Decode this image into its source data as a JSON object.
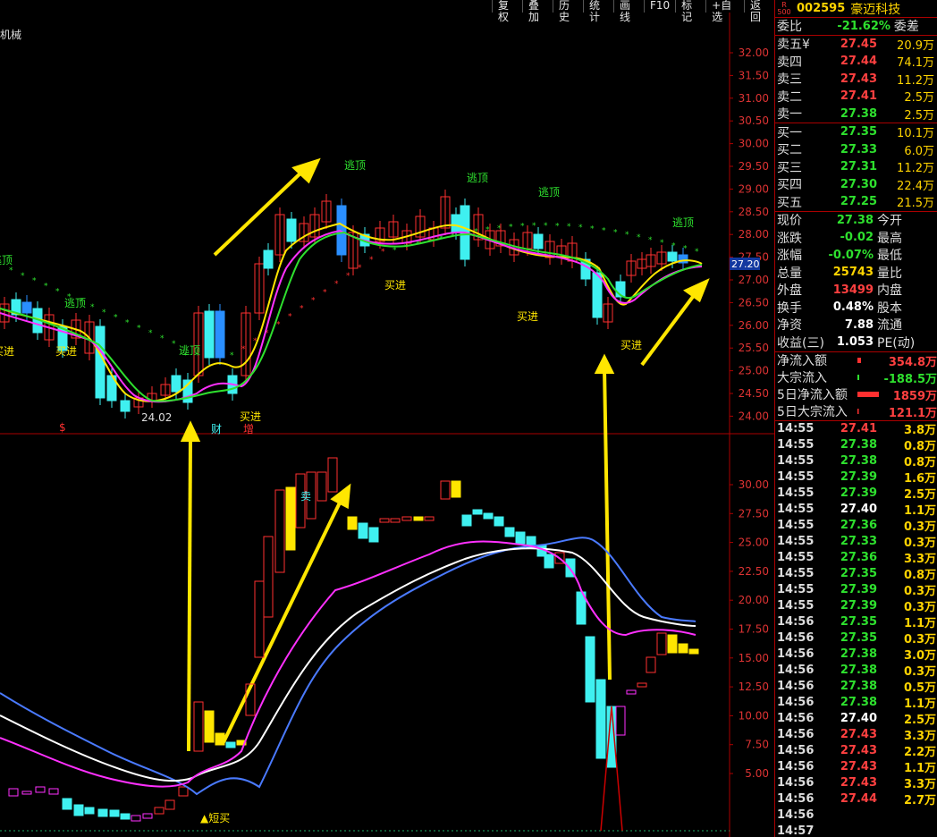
{
  "toolbar": {
    "items": [
      "复权",
      "叠加",
      "历史",
      "统计",
      "画线",
      "F10",
      "标记",
      "+自选",
      "返回"
    ]
  },
  "stock": {
    "code": "002595",
    "name": "豪迈科技",
    "sector_tag": "机械",
    "logo_top": "R",
    "logo_bottom": "500"
  },
  "chart_labels": {
    "current_price_tag": "27.20",
    "low_label": "24.02",
    "signals": {
      "escape_top": "逃顶",
      "buy_in": "买进",
      "sell_in": "卖进",
      "sell": "卖",
      "short_buy": "▲短买",
      "cai": "财",
      "zeng": "增",
      "dollar": "$"
    },
    "upper_axis": [
      "32.00",
      "31.50",
      "31.00",
      "30.50",
      "30.00",
      "29.50",
      "29.00",
      "28.50",
      "28.00",
      "27.50",
      "27.00",
      "26.50",
      "26.00",
      "25.50",
      "25.00",
      "24.50",
      "24.00"
    ],
    "lower_axis": [
      "30.00",
      "27.50",
      "25.00",
      "22.50",
      "20.00",
      "17.50",
      "15.00",
      "12.50",
      "10.00",
      "7.50",
      "5.00"
    ]
  },
  "quote": {
    "ratio_label": "委比",
    "ratio_value": "-21.62%",
    "diff_label": "委差",
    "sells": [
      {
        "label": "卖五¥",
        "price": "27.45",
        "vol": "20.9万"
      },
      {
        "label": "卖四",
        "price": "27.44",
        "vol": "74.1万"
      },
      {
        "label": "卖三",
        "price": "27.43",
        "vol": "11.2万"
      },
      {
        "label": "卖二",
        "price": "27.41",
        "vol": "2.5万"
      },
      {
        "label": "卖一",
        "price": "27.38",
        "vol": "2.5万"
      }
    ],
    "buys": [
      {
        "label": "买一",
        "price": "27.35",
        "vol": "10.1万"
      },
      {
        "label": "买二",
        "price": "27.33",
        "vol": "6.0万"
      },
      {
        "label": "买三",
        "price": "27.31",
        "vol": "11.2万"
      },
      {
        "label": "买四",
        "price": "27.30",
        "vol": "22.4万"
      },
      {
        "label": "买五",
        "price": "27.25",
        "vol": "21.5万"
      }
    ]
  },
  "fundamentals": [
    {
      "label": "现价",
      "value": "27.38",
      "right": "今开",
      "color": "green"
    },
    {
      "label": "涨跌",
      "value": "-0.02",
      "right": "最高",
      "color": "green"
    },
    {
      "label": "涨幅",
      "value": "-0.07%",
      "right": "最低",
      "color": "green"
    },
    {
      "label": "总量",
      "value": "25743",
      "right": "量比",
      "color": "yellow"
    },
    {
      "label": "外盘",
      "value": "13499",
      "right": "内盘",
      "color": "red"
    },
    {
      "label": "换手",
      "value": "0.48%",
      "right": "股本",
      "color": "white"
    },
    {
      "label": "净资",
      "value": "7.88",
      "right": "流通",
      "color": "white"
    },
    {
      "label": "收益(三)",
      "value": "1.053",
      "right": "PE(动)",
      "color": "white"
    }
  ],
  "flows": [
    {
      "label": "净流入额",
      "value": "354.8万",
      "color": "red",
      "bar": 6
    },
    {
      "label": "大宗流入",
      "value": "-188.5万",
      "color": "green",
      "bar": 3
    },
    {
      "label": "5日净流入额",
      "value": "1859万",
      "color": "red",
      "bar": 34
    },
    {
      "label": "5日大宗流入",
      "value": "121.1万",
      "color": "red",
      "bar": 2
    }
  ],
  "ticks": [
    {
      "time": "14:55",
      "price": "27.41",
      "vol": "3.8万",
      "color": "red"
    },
    {
      "time": "14:55",
      "price": "27.38",
      "vol": "0.8万",
      "color": "green"
    },
    {
      "time": "14:55",
      "price": "27.38",
      "vol": "0.8万",
      "color": "green"
    },
    {
      "time": "14:55",
      "price": "27.39",
      "vol": "1.6万",
      "color": "green"
    },
    {
      "time": "14:55",
      "price": "27.39",
      "vol": "2.5万",
      "color": "green"
    },
    {
      "time": "14:55",
      "price": "27.40",
      "vol": "1.1万",
      "color": "white"
    },
    {
      "time": "14:55",
      "price": "27.36",
      "vol": "0.3万",
      "color": "green"
    },
    {
      "time": "14:55",
      "price": "27.33",
      "vol": "0.3万",
      "color": "green"
    },
    {
      "time": "14:55",
      "price": "27.36",
      "vol": "3.3万",
      "color": "green"
    },
    {
      "time": "14:55",
      "price": "27.35",
      "vol": "0.8万",
      "color": "green"
    },
    {
      "time": "14:55",
      "price": "27.39",
      "vol": "0.3万",
      "color": "green"
    },
    {
      "time": "14:55",
      "price": "27.39",
      "vol": "0.3万",
      "color": "green"
    },
    {
      "time": "14:56",
      "price": "27.35",
      "vol": "1.1万",
      "color": "green"
    },
    {
      "time": "14:56",
      "price": "27.35",
      "vol": "0.3万",
      "color": "green"
    },
    {
      "time": "14:56",
      "price": "27.38",
      "vol": "3.0万",
      "color": "green"
    },
    {
      "time": "14:56",
      "price": "27.38",
      "vol": "0.3万",
      "color": "green"
    },
    {
      "time": "14:56",
      "price": "27.38",
      "vol": "0.5万",
      "color": "green"
    },
    {
      "time": "14:56",
      "price": "27.38",
      "vol": "1.1万",
      "color": "green"
    },
    {
      "time": "14:56",
      "price": "27.40",
      "vol": "2.5万",
      "color": "white"
    },
    {
      "time": "14:56",
      "price": "27.43",
      "vol": "3.3万",
      "color": "red"
    },
    {
      "time": "14:56",
      "price": "27.43",
      "vol": "2.2万",
      "color": "red"
    },
    {
      "time": "14:56",
      "price": "27.43",
      "vol": "1.1万",
      "color": "red"
    },
    {
      "time": "14:56",
      "price": "27.43",
      "vol": "3.3万",
      "color": "red"
    },
    {
      "time": "14:56",
      "price": "27.44",
      "vol": "2.7万",
      "color": "red"
    },
    {
      "time": "14:56",
      "price": "",
      "vol": "",
      "color": "white"
    },
    {
      "time": "14:57",
      "price": "",
      "vol": "",
      "color": "white"
    }
  ]
}
